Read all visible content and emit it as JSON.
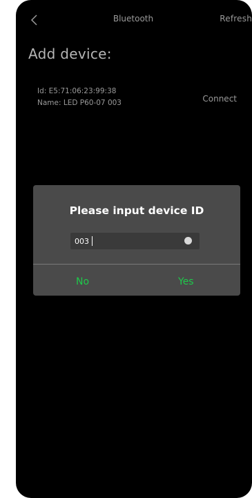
{
  "header": {
    "back_icon": "chevron-left-icon",
    "title": "Bluetooth",
    "refresh_label": "Refresh"
  },
  "main": {
    "section_title": "Add device:",
    "devices": [
      {
        "id_line": "Id: E5:71:06:23:99:38",
        "name_line": "Name: LED P60-07 003",
        "action_label": "Connect"
      }
    ]
  },
  "dialog": {
    "title": "Please input device ID",
    "input_value": "003",
    "clear_icon": "clear-circle-icon",
    "no_label": "No",
    "yes_label": "Yes"
  },
  "colors": {
    "background": "#000000",
    "dialog_bg": "#4a4a4a",
    "accent_green": "#1ec94a",
    "muted_text": "#9a9a9a"
  }
}
